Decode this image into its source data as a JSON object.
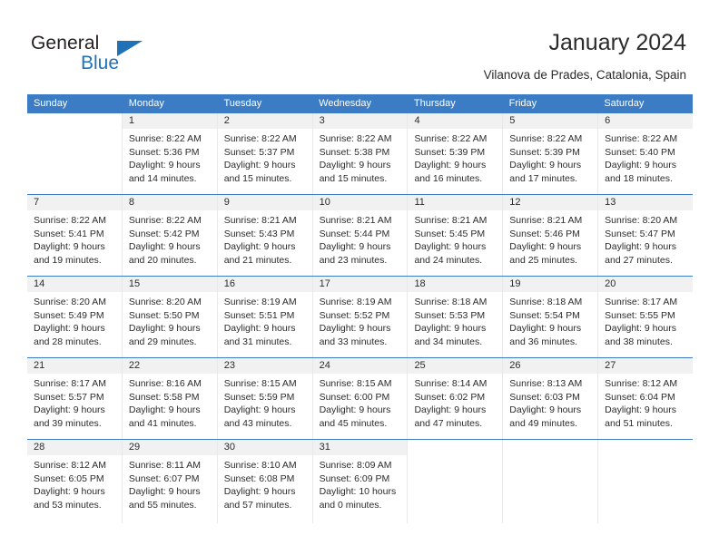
{
  "brand": {
    "name_part1": "General",
    "name_part2": "Blue",
    "accent_color": "#1f71b8"
  },
  "header": {
    "title": "January 2024",
    "location": "Vilanova de Prades, Catalonia, Spain"
  },
  "calendar": {
    "header_bg": "#3b7cc4",
    "weekdays": [
      "Sunday",
      "Monday",
      "Tuesday",
      "Wednesday",
      "Thursday",
      "Friday",
      "Saturday"
    ],
    "weeks": [
      [
        {
          "day": "",
          "lines": []
        },
        {
          "day": "1",
          "lines": [
            "Sunrise: 8:22 AM",
            "Sunset: 5:36 PM",
            "Daylight: 9 hours",
            "and 14 minutes."
          ]
        },
        {
          "day": "2",
          "lines": [
            "Sunrise: 8:22 AM",
            "Sunset: 5:37 PM",
            "Daylight: 9 hours",
            "and 15 minutes."
          ]
        },
        {
          "day": "3",
          "lines": [
            "Sunrise: 8:22 AM",
            "Sunset: 5:38 PM",
            "Daylight: 9 hours",
            "and 15 minutes."
          ]
        },
        {
          "day": "4",
          "lines": [
            "Sunrise: 8:22 AM",
            "Sunset: 5:39 PM",
            "Daylight: 9 hours",
            "and 16 minutes."
          ]
        },
        {
          "day": "5",
          "lines": [
            "Sunrise: 8:22 AM",
            "Sunset: 5:39 PM",
            "Daylight: 9 hours",
            "and 17 minutes."
          ]
        },
        {
          "day": "6",
          "lines": [
            "Sunrise: 8:22 AM",
            "Sunset: 5:40 PM",
            "Daylight: 9 hours",
            "and 18 minutes."
          ]
        }
      ],
      [
        {
          "day": "7",
          "lines": [
            "Sunrise: 8:22 AM",
            "Sunset: 5:41 PM",
            "Daylight: 9 hours",
            "and 19 minutes."
          ]
        },
        {
          "day": "8",
          "lines": [
            "Sunrise: 8:22 AM",
            "Sunset: 5:42 PM",
            "Daylight: 9 hours",
            "and 20 minutes."
          ]
        },
        {
          "day": "9",
          "lines": [
            "Sunrise: 8:21 AM",
            "Sunset: 5:43 PM",
            "Daylight: 9 hours",
            "and 21 minutes."
          ]
        },
        {
          "day": "10",
          "lines": [
            "Sunrise: 8:21 AM",
            "Sunset: 5:44 PM",
            "Daylight: 9 hours",
            "and 23 minutes."
          ]
        },
        {
          "day": "11",
          "lines": [
            "Sunrise: 8:21 AM",
            "Sunset: 5:45 PM",
            "Daylight: 9 hours",
            "and 24 minutes."
          ]
        },
        {
          "day": "12",
          "lines": [
            "Sunrise: 8:21 AM",
            "Sunset: 5:46 PM",
            "Daylight: 9 hours",
            "and 25 minutes."
          ]
        },
        {
          "day": "13",
          "lines": [
            "Sunrise: 8:20 AM",
            "Sunset: 5:47 PM",
            "Daylight: 9 hours",
            "and 27 minutes."
          ]
        }
      ],
      [
        {
          "day": "14",
          "lines": [
            "Sunrise: 8:20 AM",
            "Sunset: 5:49 PM",
            "Daylight: 9 hours",
            "and 28 minutes."
          ]
        },
        {
          "day": "15",
          "lines": [
            "Sunrise: 8:20 AM",
            "Sunset: 5:50 PM",
            "Daylight: 9 hours",
            "and 29 minutes."
          ]
        },
        {
          "day": "16",
          "lines": [
            "Sunrise: 8:19 AM",
            "Sunset: 5:51 PM",
            "Daylight: 9 hours",
            "and 31 minutes."
          ]
        },
        {
          "day": "17",
          "lines": [
            "Sunrise: 8:19 AM",
            "Sunset: 5:52 PM",
            "Daylight: 9 hours",
            "and 33 minutes."
          ]
        },
        {
          "day": "18",
          "lines": [
            "Sunrise: 8:18 AM",
            "Sunset: 5:53 PM",
            "Daylight: 9 hours",
            "and 34 minutes."
          ]
        },
        {
          "day": "19",
          "lines": [
            "Sunrise: 8:18 AM",
            "Sunset: 5:54 PM",
            "Daylight: 9 hours",
            "and 36 minutes."
          ]
        },
        {
          "day": "20",
          "lines": [
            "Sunrise: 8:17 AM",
            "Sunset: 5:55 PM",
            "Daylight: 9 hours",
            "and 38 minutes."
          ]
        }
      ],
      [
        {
          "day": "21",
          "lines": [
            "Sunrise: 8:17 AM",
            "Sunset: 5:57 PM",
            "Daylight: 9 hours",
            "and 39 minutes."
          ]
        },
        {
          "day": "22",
          "lines": [
            "Sunrise: 8:16 AM",
            "Sunset: 5:58 PM",
            "Daylight: 9 hours",
            "and 41 minutes."
          ]
        },
        {
          "day": "23",
          "lines": [
            "Sunrise: 8:15 AM",
            "Sunset: 5:59 PM",
            "Daylight: 9 hours",
            "and 43 minutes."
          ]
        },
        {
          "day": "24",
          "lines": [
            "Sunrise: 8:15 AM",
            "Sunset: 6:00 PM",
            "Daylight: 9 hours",
            "and 45 minutes."
          ]
        },
        {
          "day": "25",
          "lines": [
            "Sunrise: 8:14 AM",
            "Sunset: 6:02 PM",
            "Daylight: 9 hours",
            "and 47 minutes."
          ]
        },
        {
          "day": "26",
          "lines": [
            "Sunrise: 8:13 AM",
            "Sunset: 6:03 PM",
            "Daylight: 9 hours",
            "and 49 minutes."
          ]
        },
        {
          "day": "27",
          "lines": [
            "Sunrise: 8:12 AM",
            "Sunset: 6:04 PM",
            "Daylight: 9 hours",
            "and 51 minutes."
          ]
        }
      ],
      [
        {
          "day": "28",
          "lines": [
            "Sunrise: 8:12 AM",
            "Sunset: 6:05 PM",
            "Daylight: 9 hours",
            "and 53 minutes."
          ]
        },
        {
          "day": "29",
          "lines": [
            "Sunrise: 8:11 AM",
            "Sunset: 6:07 PM",
            "Daylight: 9 hours",
            "and 55 minutes."
          ]
        },
        {
          "day": "30",
          "lines": [
            "Sunrise: 8:10 AM",
            "Sunset: 6:08 PM",
            "Daylight: 9 hours",
            "and 57 minutes."
          ]
        },
        {
          "day": "31",
          "lines": [
            "Sunrise: 8:09 AM",
            "Sunset: 6:09 PM",
            "Daylight: 10 hours",
            "and 0 minutes."
          ]
        },
        {
          "day": "",
          "lines": []
        },
        {
          "day": "",
          "lines": []
        },
        {
          "day": "",
          "lines": []
        }
      ]
    ]
  }
}
